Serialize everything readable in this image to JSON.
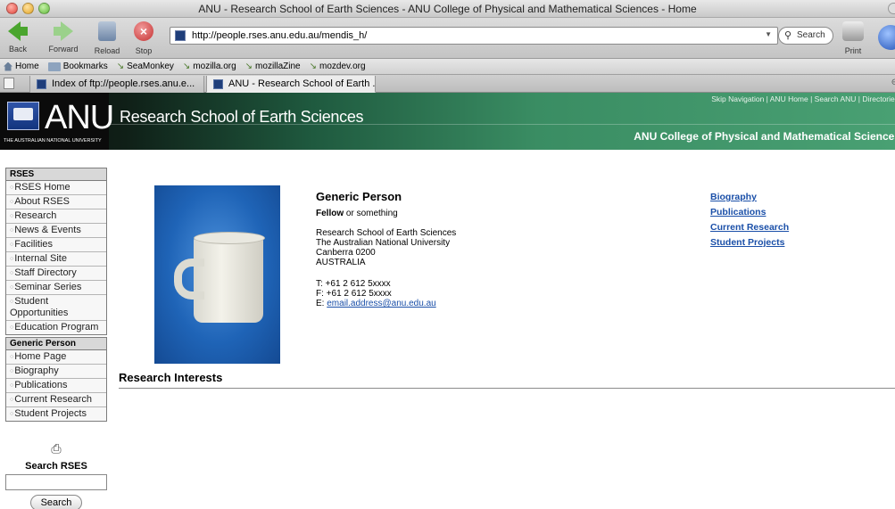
{
  "window": {
    "title": "ANU - Research School of Earth Sciences - ANU College of Physical and Mathematical Sciences - Home"
  },
  "toolbar": {
    "back_label": "Back",
    "forward_label": "Forward",
    "reload_label": "Reload",
    "stop_label": "Stop",
    "url": "http://people.rses.anu.edu.au/mendis_h/",
    "search_placeholder": "Search",
    "print_label": "Print"
  },
  "bookmarks": [
    "Home",
    "Bookmarks",
    "SeaMonkey",
    "mozilla.org",
    "mozillaZine",
    "mozdev.org"
  ],
  "tabs": [
    {
      "label": "Index of ftp://people.rses.anu.e...",
      "active": false
    },
    {
      "label": "ANU - Research School of Earth ...",
      "active": true
    }
  ],
  "header": {
    "logo_text": "ANU",
    "logo_subtext": "THE AUSTRALIAN NATIONAL UNIVERSITY",
    "site_title": "Research School of Earth Sciences",
    "skip_nav": "Skip Navigation | ANU Home | Search ANU | Directories",
    "college": "ANU College of Physical and Mathematical Sciences"
  },
  "sidebar": {
    "rses_heading": "RSES",
    "rses_items": [
      "RSES Home",
      "About RSES",
      "Research",
      "News & Events",
      "Facilities",
      "Internal Site",
      "Staff Directory",
      "Seminar Series",
      "Student Opportunities",
      "Education Program"
    ],
    "person_heading": "Generic Person",
    "person_items": [
      "Home Page",
      "Biography",
      "Publications",
      "Current Research",
      "Student Projects"
    ],
    "search_label": "Search RSES",
    "search_button": "Search"
  },
  "profile": {
    "name": "Generic Person",
    "title_bold": "Fellow",
    "title_rest": " or something",
    "address": [
      "Research School of Earth Sciences",
      "The Australian National University",
      "Canberra 0200",
      "AUSTRALIA"
    ],
    "phone": "T: +61 2 612 5xxxx",
    "fax": "F: +61 2 612 5xxxx",
    "email_prefix": "E: ",
    "email": "email.address@anu.edu.au",
    "links": [
      "Biography",
      "Publications",
      "Current Research",
      "Student Projects"
    ],
    "research_heading": "Research Interests"
  },
  "colors": {
    "link": "#1a4fa8",
    "header_green": "#3a8d63"
  }
}
